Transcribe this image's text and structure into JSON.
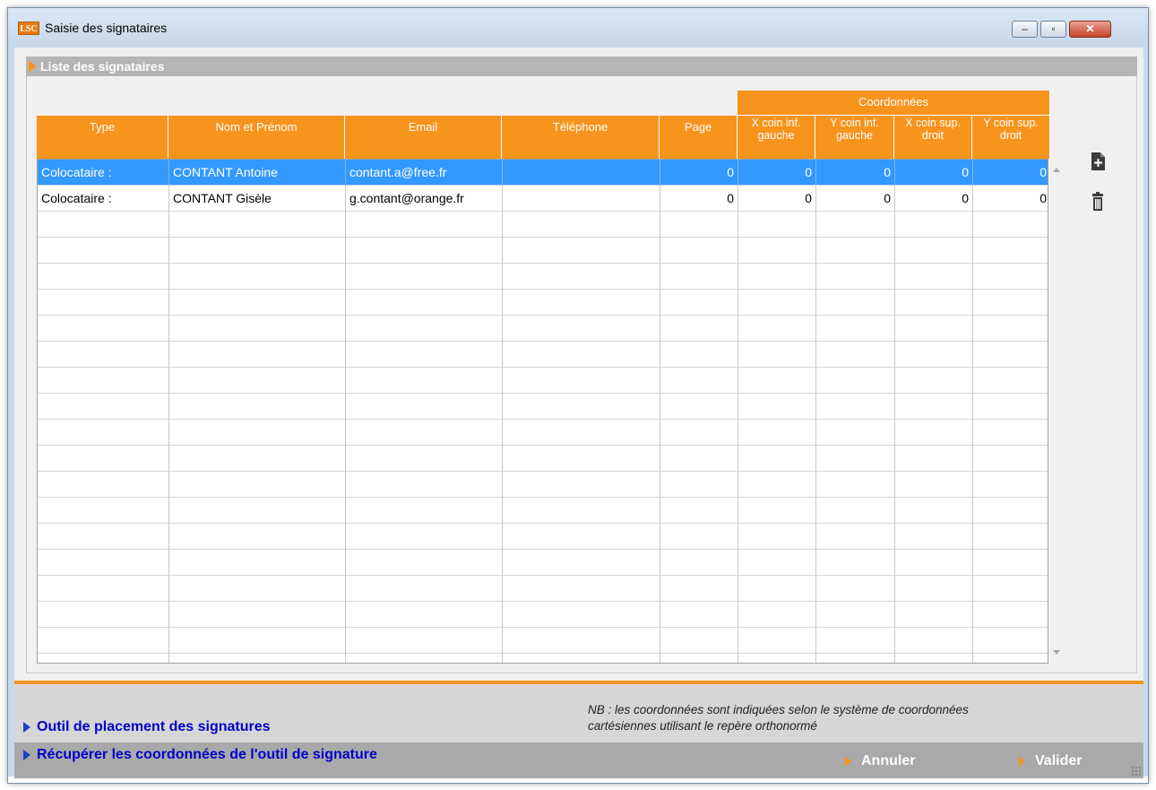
{
  "window": {
    "logo": "LSC",
    "title": "Saisie des signataires",
    "minimize": "–",
    "maximize": "▫",
    "close": "✕"
  },
  "section": {
    "title": "Liste des signataires"
  },
  "table": {
    "group_header": "Coordonnées",
    "columns": [
      "Type",
      "Nom et Prénom",
      "Email",
      "Téléphone",
      "Page",
      "X coin inf. gauche",
      "Y coin inf. gauche",
      "X coin sup. droit",
      "Y coin sup. droit"
    ],
    "rows": [
      [
        "Colocataire :",
        "CONTANT Antoine",
        "contant.a@free.fr",
        "",
        "0",
        "0",
        "0",
        "0",
        "0"
      ],
      [
        "Colocataire :",
        "CONTANT Gisèle",
        "g.contant@orange.fr",
        "",
        "0",
        "0",
        "0",
        "0",
        "0"
      ]
    ],
    "selected_row": 0
  },
  "side_buttons": {
    "add_icon": "add-document-icon",
    "delete_icon": "trash-icon"
  },
  "footer": {
    "link_placement": "Outil de placement des signatures",
    "link_retrieve": "Récupérer les coordonnées de l'outil de signature",
    "note_line1": "NB : les coordonnées sont indiquées  selon  le système de coordonnées",
    "note_line2": "cartésiennes utilisant le repère orthonormé",
    "cancel": "Annuler",
    "validate": "Valider"
  },
  "colors": {
    "accent": "#f7941d",
    "selection": "#3399ff",
    "link": "#0000cc"
  }
}
